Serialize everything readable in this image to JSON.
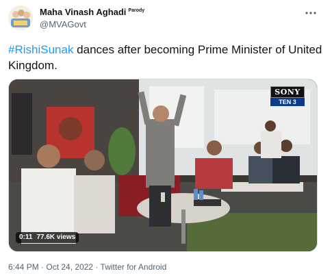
{
  "tweet": {
    "display_name": "Maha Vinash Aghadi",
    "parody_label": "Parody",
    "handle": "@MVAGovt",
    "hashtag": "#RishiSunak",
    "text_after_hashtag": " dances after becoming Prime Minister of United Kingdom.",
    "more_icon": "more-dots-icon"
  },
  "media": {
    "type": "video",
    "duration": "0:11",
    "views": "77.6K views",
    "channel_brand": "SONY",
    "channel_name": "TEN 3"
  },
  "footer": {
    "time": "6:44 PM",
    "separator": " · ",
    "date": "Oct 24, 2022",
    "source": "Twitter for Android"
  }
}
